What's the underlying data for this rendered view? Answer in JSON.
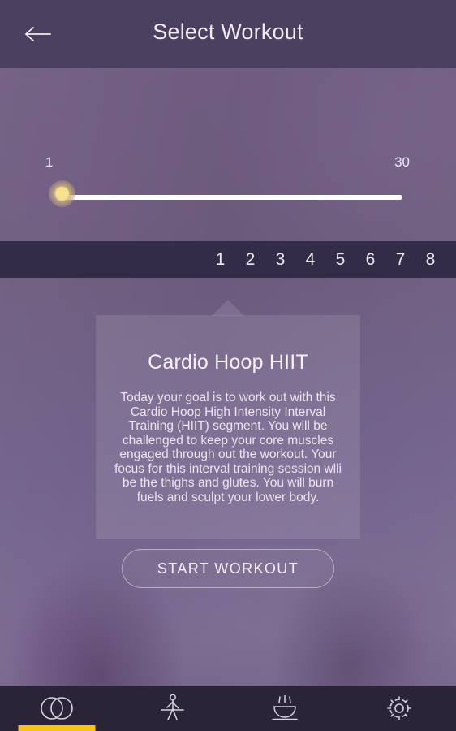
{
  "header": {
    "title": "Select Workout",
    "back_icon": "arrow-left-icon"
  },
  "slider": {
    "min_label": "1",
    "max_label": "30",
    "value": 1,
    "min": 1,
    "max": 30,
    "thumb_color": "#f5e08a",
    "track_color": "#ffffff"
  },
  "number_strip": {
    "items": [
      "1",
      "2",
      "3",
      "4",
      "5",
      "6",
      "7",
      "8"
    ],
    "selected": "1",
    "background": "#332c46"
  },
  "card": {
    "title": "Cardio Hoop HIIT",
    "description": "Today your goal is to work out with this Cardio Hoop High Intensity Interval Training (HIIT) segment. You will be challenged to keep your core muscles engaged through out the workout. Your focus for this interval training session wlli be the thighs and glutes. You will burn fuels and sculpt your lower body."
  },
  "start_button": {
    "label": "START WORKOUT"
  },
  "bottom_nav": {
    "active_index": 0,
    "active_color": "#f5c417",
    "items": [
      {
        "icon": "hoop-rings-icon",
        "active": true
      },
      {
        "icon": "person-exercise-icon",
        "active": false
      },
      {
        "icon": "nutrition-bowl-icon",
        "active": false
      },
      {
        "icon": "gear-icon",
        "active": false
      }
    ]
  },
  "theme": {
    "header_bg": "#4b4060",
    "body_bg": "#6d5a7d",
    "nav_bg": "#2a2438",
    "accent": "#f5c417"
  }
}
